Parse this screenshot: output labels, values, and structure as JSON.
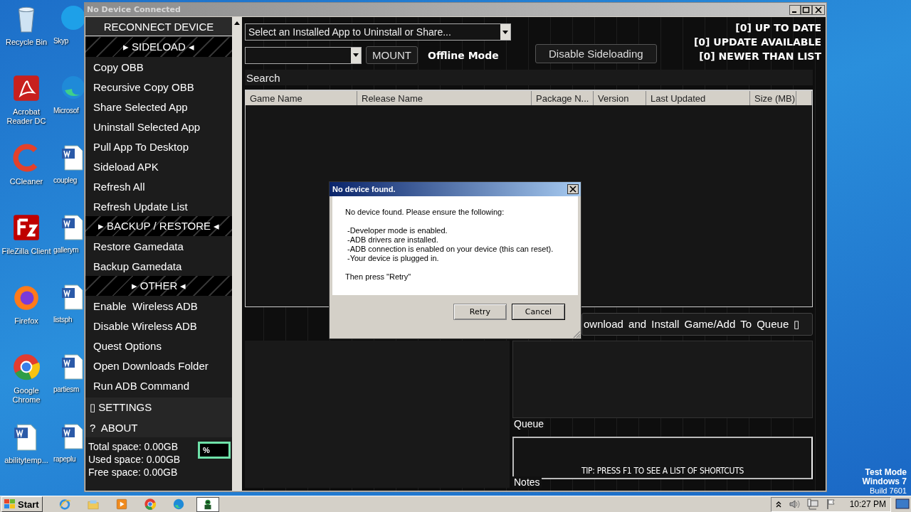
{
  "desktop": {
    "icons": [
      {
        "label": "Recycle Bin",
        "kind": "recycle"
      },
      {
        "label": "Skyp",
        "kind": "skype"
      },
      {
        "label": "Acrobat Reader DC",
        "kind": "acrobat"
      },
      {
        "label": "Microsof",
        "kind": "edge"
      },
      {
        "label": "CCleaner",
        "kind": "ccleaner"
      },
      {
        "label": "coupleg",
        "kind": "word"
      },
      {
        "label": "FileZilla Client",
        "kind": "filezilla"
      },
      {
        "label": "gallerym",
        "kind": "word"
      },
      {
        "label": "Firefox",
        "kind": "firefox"
      },
      {
        "label": "listsph",
        "kind": "word"
      },
      {
        "label": "Google Chrome",
        "kind": "chrome"
      },
      {
        "label": "partiesm",
        "kind": "word"
      },
      {
        "label": "abilitytemp...",
        "kind": "word"
      },
      {
        "label": "rapeplu",
        "kind": "word"
      }
    ],
    "os_notice": [
      "Test Mode",
      "Windows 7",
      "Build 7601"
    ]
  },
  "window": {
    "title": "No Device Connected"
  },
  "sidebar": {
    "reconnect": "RECONNECT DEVICE",
    "sections": [
      {
        "header": "▸ SIDELOAD ◂",
        "items": [
          "Copy OBB",
          "Recursive Copy OBB",
          "Share Selected App",
          "Uninstall Selected App",
          "Pull App To Desktop",
          "Sideload APK",
          "Refresh All",
          "Refresh Update List"
        ]
      },
      {
        "header": "▸ BACKUP / RESTORE ◂",
        "items": [
          "Restore Gamedata",
          "Backup Gamedata"
        ]
      },
      {
        "header": "▸ OTHER ◂",
        "items": [
          "Enable  Wireless ADB",
          "Disable Wireless ADB",
          "Quest Options",
          "Open Downloads Folder",
          "Run ADB Command"
        ]
      }
    ],
    "footer_items": [
      "▯ SETTINGS",
      "?  ABOUT"
    ],
    "storage": [
      "Total space: 0.00GB",
      "Used space: 0.00GB",
      "Free space: 0.00GB"
    ],
    "percent": "%"
  },
  "toolbar": {
    "app_select": {
      "value": "Select an Installed App to Uninstall or Share..."
    },
    "mount_button": "MOUNT",
    "mode": "Offline Mode",
    "sideload_button": "Disable Sideloading",
    "status": [
      "[0] UP TO DATE",
      "[0] UPDATE AVAILABLE",
      "[0] NEWER THAN LIST"
    ]
  },
  "search": {
    "placeholder": "Search"
  },
  "table": {
    "columns": [
      "Game Name",
      "Release Name",
      "Package N...",
      "Version",
      "Last Updated",
      "Size (MB)"
    ]
  },
  "download_button": "ownload and Install Game/Add To Queue ▯",
  "queue": {
    "label": "Queue"
  },
  "notes": {
    "label": "Notes",
    "tip": "TIP: PRESS F1 TO SEE A LIST OF SHORTCUTS"
  },
  "dialog": {
    "title": "No device found.",
    "intro": "No device found. Please ensure the following:",
    "checks": [
      "-Developer mode is enabled.",
      "-ADB drivers are installed.",
      "-ADB connection is enabled on your device (this can reset).",
      "-Your device is plugged in."
    ],
    "outro": "Then press \"Retry\"",
    "buttons": [
      "Retry",
      "Cancel"
    ]
  },
  "taskbar": {
    "start": "Start",
    "apps": [
      {
        "kind": "ie",
        "selected": false
      },
      {
        "kind": "folder",
        "selected": false
      },
      {
        "kind": "media",
        "selected": false
      },
      {
        "kind": "chrome",
        "selected": false
      },
      {
        "kind": "edge",
        "selected": false
      },
      {
        "kind": "robot",
        "selected": true
      }
    ],
    "clock": "10:27 PM"
  }
}
